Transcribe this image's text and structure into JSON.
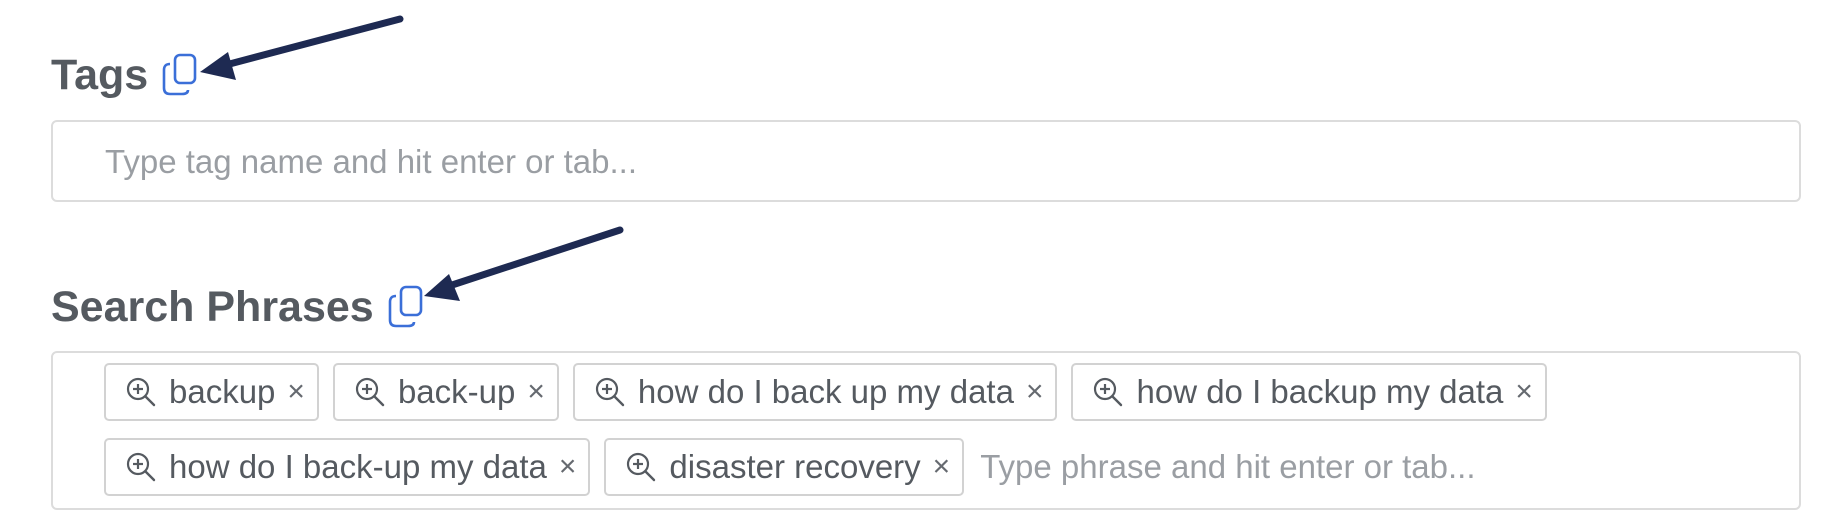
{
  "tags": {
    "title": "Tags",
    "copy_icon": "copy-icon",
    "input_placeholder": "Type tag name and hit enter or tab...",
    "input_value": ""
  },
  "search_phrases": {
    "title": "Search Phrases",
    "copy_icon": "copy-icon",
    "chips": [
      {
        "label": "backup",
        "icon": "zoom-in-icon",
        "remove": "×"
      },
      {
        "label": "back-up",
        "icon": "zoom-in-icon",
        "remove": "×"
      },
      {
        "label": "how do I back up my data",
        "icon": "zoom-in-icon",
        "remove": "×"
      },
      {
        "label": "how do I backup my data",
        "icon": "zoom-in-icon",
        "remove": "×"
      },
      {
        "label": "how do I back-up my data",
        "icon": "zoom-in-icon",
        "remove": "×"
      },
      {
        "label": "disaster recovery",
        "icon": "zoom-in-icon",
        "remove": "×"
      }
    ],
    "input_placeholder": "Type phrase and hit enter or tab...",
    "input_value": ""
  },
  "colors": {
    "title_text": "#555a60",
    "copy_icon": "#3b6fd8",
    "arrow": "#1e2a52",
    "border": "#dcdcdc",
    "placeholder": "#9a9ea3"
  }
}
